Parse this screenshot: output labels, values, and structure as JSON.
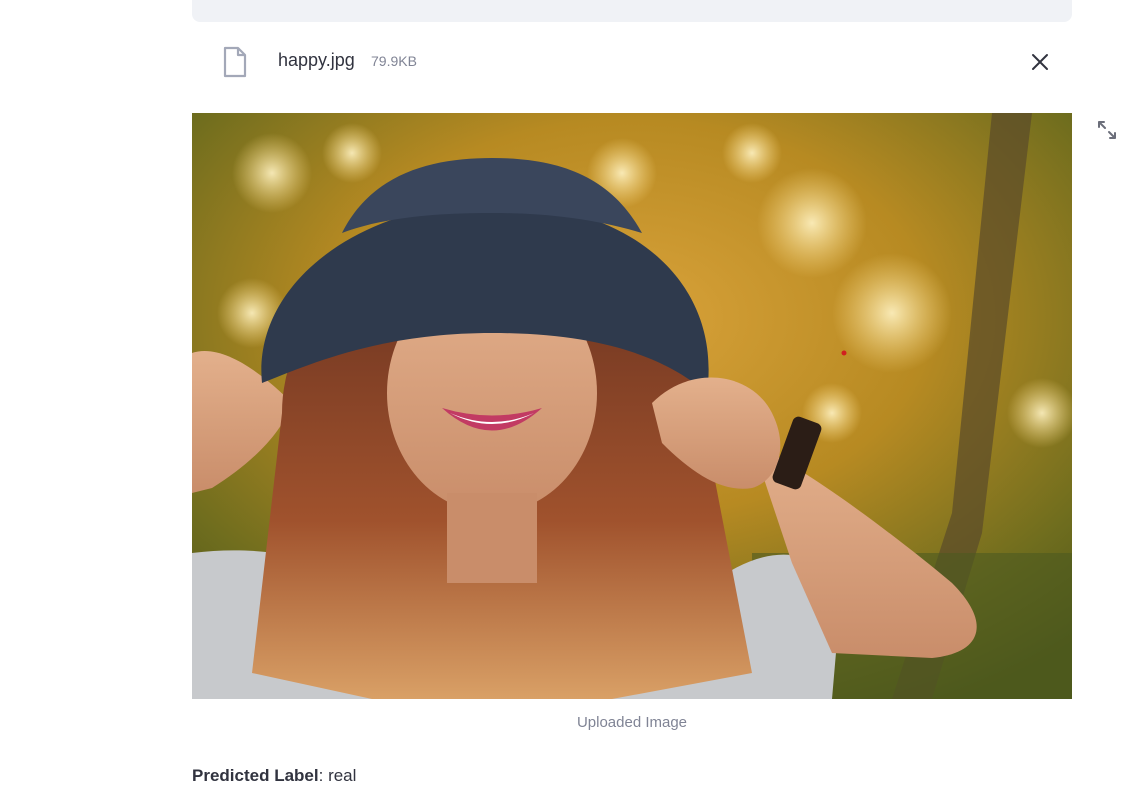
{
  "file": {
    "name": "happy.jpg",
    "size": "79.9KB"
  },
  "image": {
    "caption": "Uploaded Image"
  },
  "result": {
    "label_title": "Predicted Label",
    "separator": ": ",
    "label_value": "real"
  },
  "colors": {
    "strip": "#f0f2f6",
    "text": "#31333f",
    "muted": "#808495"
  },
  "icons": {
    "file": "file-icon",
    "close": "close-icon",
    "fullscreen": "fullscreen-icon"
  }
}
